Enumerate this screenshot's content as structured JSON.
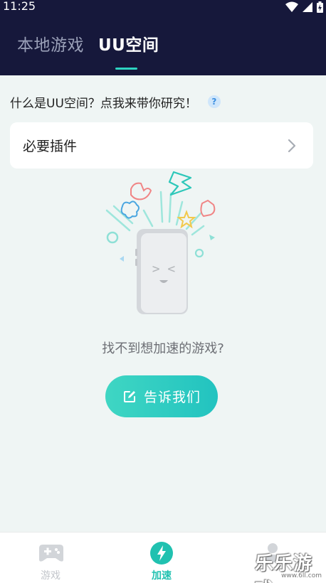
{
  "status_bar": {
    "time": "11:25",
    "icons": [
      "wifi-icon",
      "signal-icon",
      "battery-icon"
    ]
  },
  "header": {
    "tabs": [
      {
        "label": "本地游戏",
        "active": false
      },
      {
        "label": "UU空间",
        "active": true
      }
    ]
  },
  "intro": {
    "text": "什么是UU空间？点我来带你研究！",
    "help_icon": "?"
  },
  "plugin_card": {
    "label": "必要插件",
    "icon": "chevron-right-icon"
  },
  "empty_state": {
    "face": "> <",
    "message": "找不到想加速的游戏?"
  },
  "feedback_button": {
    "label": "告诉我们",
    "icon": "edit-icon"
  },
  "bottom_nav": {
    "items": [
      {
        "label": "游戏",
        "icon": "gamepad-icon",
        "active": false
      },
      {
        "label": "加速",
        "icon": "lightning-icon",
        "active": true
      },
      {
        "label": "",
        "icon": "user-icon",
        "active": false
      }
    ]
  },
  "watermark": {
    "text": "乐乐游戏",
    "url": "www.6ll.com"
  },
  "colors": {
    "header_bg": "#16183b",
    "accent": "#2dd3c0",
    "page_bg": "#eff5f4"
  }
}
